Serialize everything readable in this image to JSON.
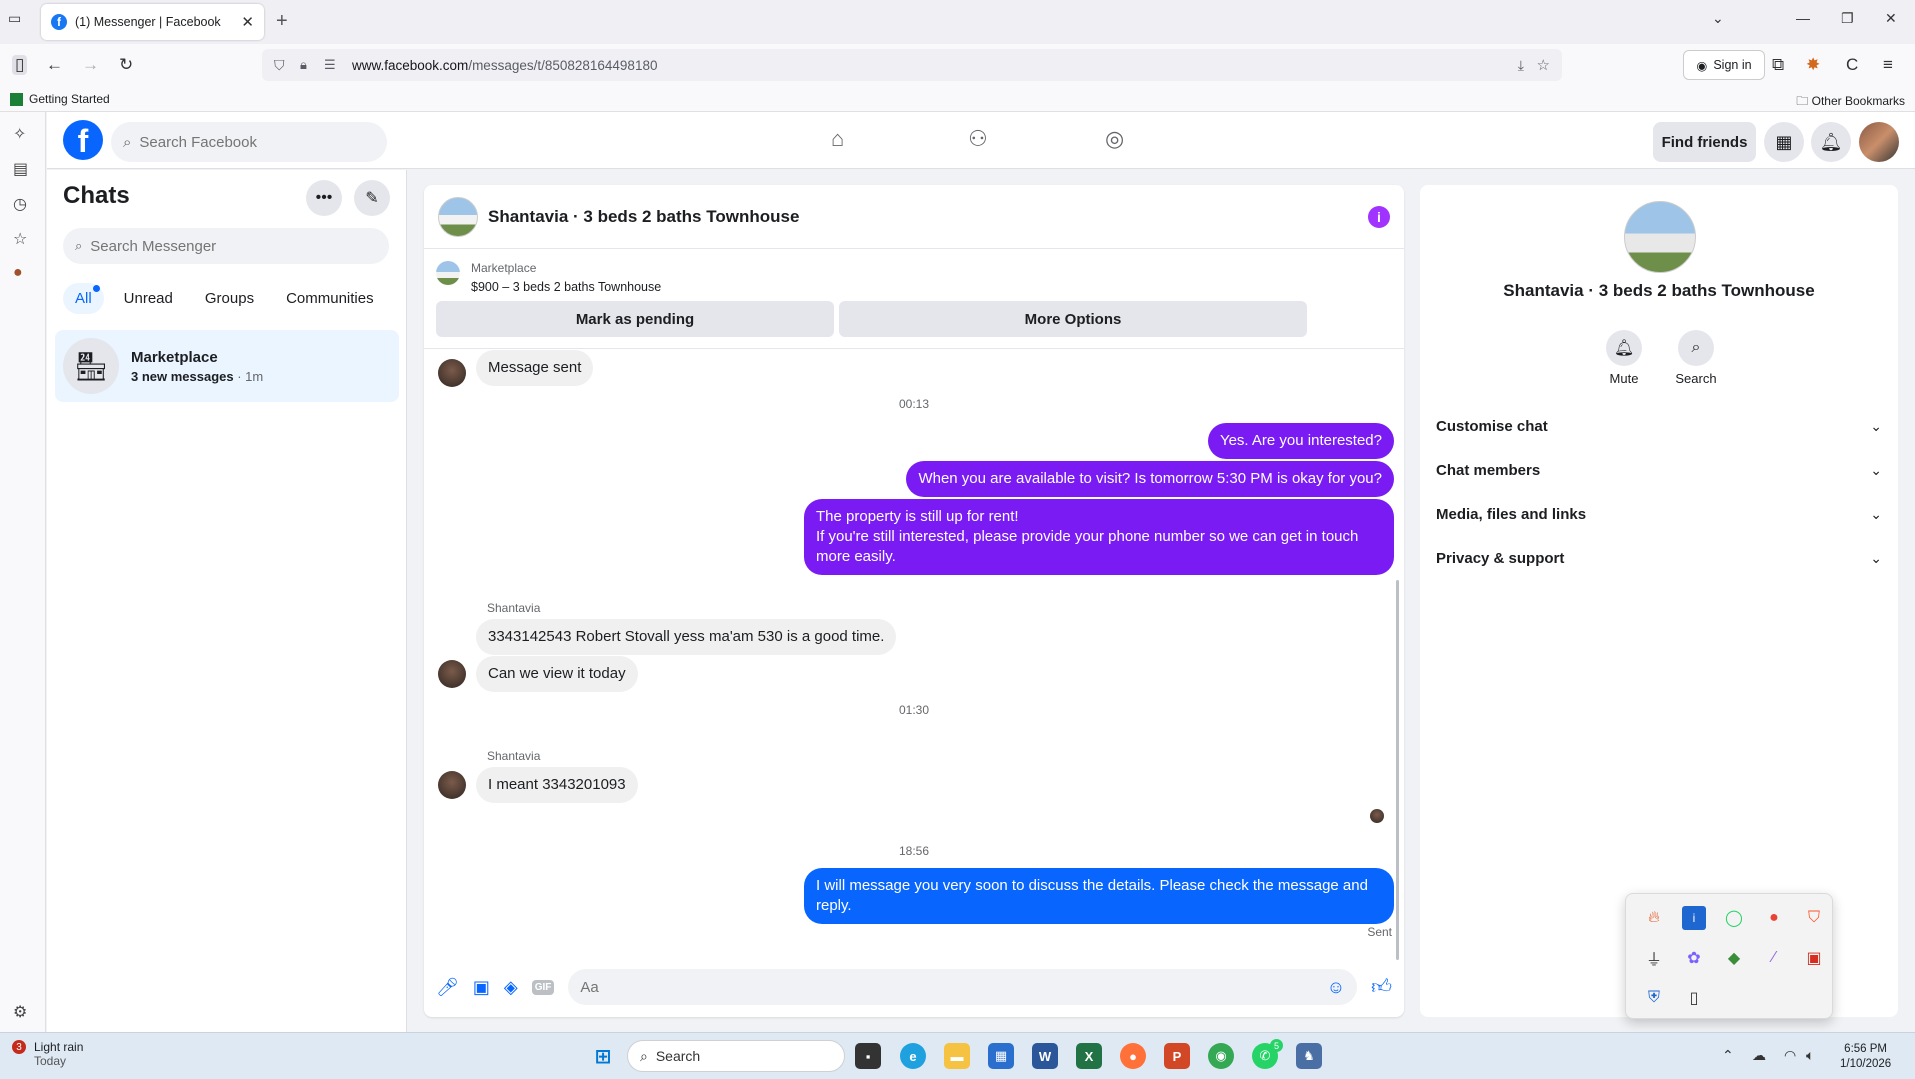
{
  "browser": {
    "tab_title": "(1) Messenger | Facebook",
    "tab_favicon": "facebook-icon",
    "url_host": "www.facebook.com",
    "url_path": "/messages/t/850828164498180",
    "sign_in": "Sign in",
    "bookmark_left": "Getting Started",
    "bookmark_right": "Other Bookmarks"
  },
  "fb": {
    "search_placeholder": "Search Facebook",
    "find_friends": "Find friends"
  },
  "chats": {
    "title": "Chats",
    "search_placeholder": "Search Messenger",
    "filters": [
      "All",
      "Unread",
      "Groups",
      "Communities"
    ],
    "conversation": {
      "name": "Marketplace",
      "preview": "3 new messages",
      "time": " · 1m"
    }
  },
  "thread": {
    "title": "Shantavia · 3 beds 2 baths Townhouse",
    "marketplace_label": "Marketplace",
    "listing": "$900 – 3 beds 2 baths Townhouse",
    "mark_pending": "Mark as pending",
    "more_options": "More Options",
    "messages": {
      "m1": "Message sent",
      "t1": "00:13",
      "m2": "Yes. Are you interested?",
      "m3": "When you are available to visit? Is tomorrow 5:30 PM is okay for you?",
      "m4_line1": "The property is still up for rent!",
      "m4_line2": "If you're still interested, please provide your phone number so we can get in touch more easily.",
      "sender1": "Shantavia",
      "m5": "3343142543 Robert Stovall yess ma'am 530 is a good time.",
      "m6": "Can we view it today",
      "t2": "01:30",
      "sender2": "Shantavia",
      "m7": "I meant 3343201093",
      "t3": "18:56",
      "m8": "I will message you very soon to discuss the details. Please check the message and reply.",
      "status": "Sent"
    },
    "composer_placeholder": "Aa"
  },
  "details": {
    "name": "Shantavia · 3 beds 2 baths Townhouse",
    "mute": "Mute",
    "search": "Search",
    "sections": [
      "Customise chat",
      "Chat members",
      "Media, files and links",
      "Privacy & support"
    ]
  },
  "taskbar": {
    "weather": "Light rain",
    "weather_sub": "Today",
    "weather_badge": "3",
    "search": "Search",
    "whatsapp_badge": "5",
    "time": "6:56 PM",
    "date": "1/10/2026"
  },
  "colors": {
    "brand_blue": "#0866ff",
    "outgoing_purple": "#7a1bf3",
    "incoming_gray": "#f0f0f0"
  }
}
